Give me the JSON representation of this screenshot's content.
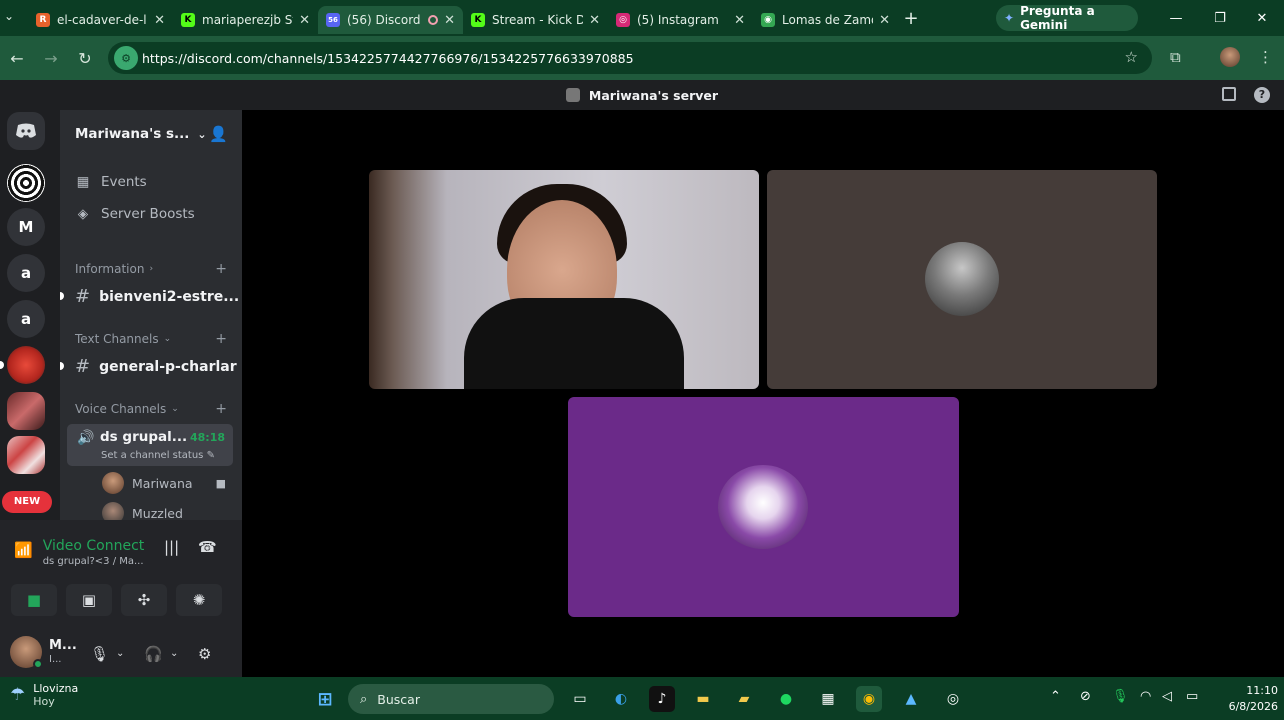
{
  "browser": {
    "tabs": [
      {
        "title": "el-cadaver-de-l",
        "fav": "R",
        "color": "#e8622c"
      },
      {
        "title": "mariaperezjb St",
        "fav": "K",
        "color": "#53fc18"
      },
      {
        "title": "(56) Discord",
        "fav": "56",
        "color": "#5865f2"
      },
      {
        "title": "Stream - Kick D",
        "fav": "K",
        "color": "#53fc18"
      },
      {
        "title": "(5) Instagram",
        "fav": "◎",
        "color": "#d62976"
      },
      {
        "title": "Lomas de Zamo",
        "fav": "◉",
        "color": "#34a853"
      }
    ],
    "gemini_label": "Pregunta a Gemini",
    "url": "https://discord.com/channels/1534225774427766976/1534225776633970885"
  },
  "discord": {
    "window_title": "Mariwana's server",
    "server_name": "Mariwana's s...",
    "rail": [
      "M",
      "a",
      "a"
    ],
    "new_badge": "NEW",
    "menu": [
      {
        "label": "Events",
        "icon": "calendar-icon"
      },
      {
        "label": "Server Boosts",
        "icon": "boost-icon"
      }
    ],
    "categories": {
      "information": "Information",
      "text": "Text Channels",
      "voice": "Voice Channels"
    },
    "channels": {
      "info_channel": "bienveni2-estre...",
      "text_channel": "general-p-charlar"
    },
    "voice_channel": {
      "name": "ds grupal...",
      "time": "48:18",
      "status": "Set a channel status",
      "users": [
        "Mariwana",
        "Muzzled"
      ]
    },
    "connection": {
      "title": "Video Connected",
      "subtitle": "ds grupal?<3 / Ma..."
    },
    "user": {
      "name": "M...",
      "status": "I..."
    }
  },
  "taskbar": {
    "weather_title": "Llovizna",
    "weather_sub": "Hoy",
    "search_placeholder": "Buscar",
    "time": "11:10",
    "date": "6/8/2026"
  }
}
